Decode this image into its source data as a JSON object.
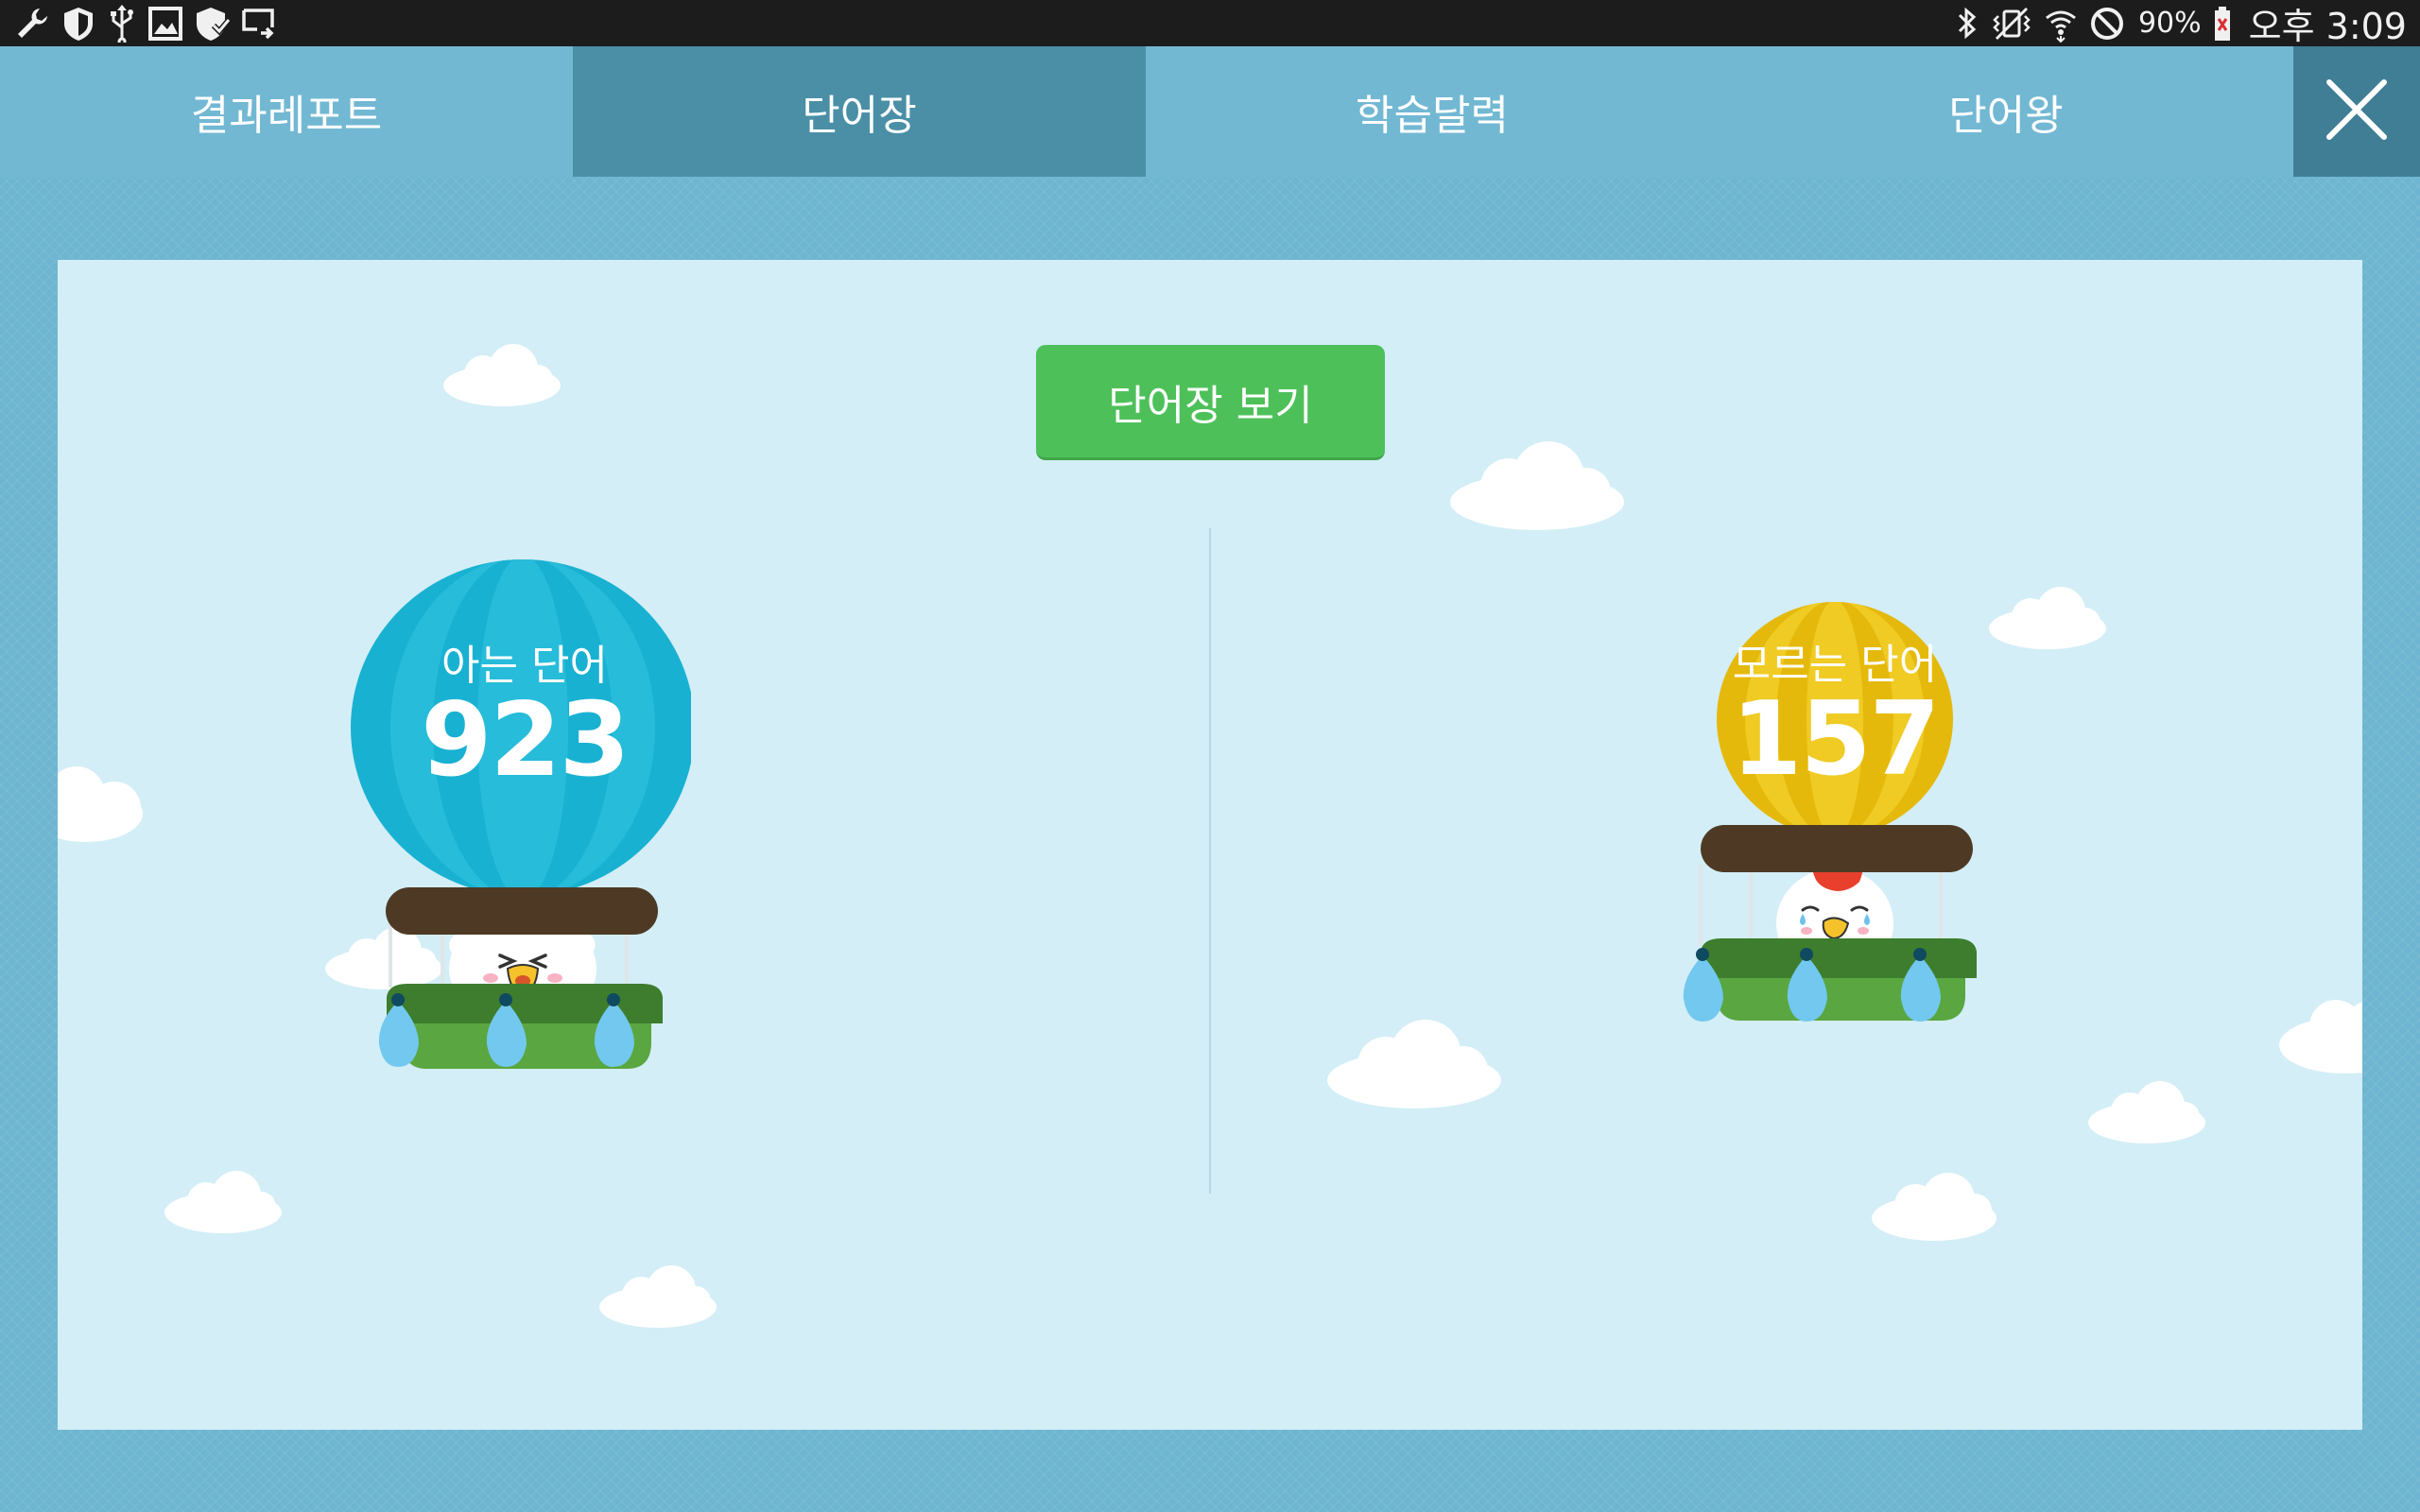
{
  "status_bar": {
    "left_icons": [
      "wrench-icon",
      "shield-icon",
      "usb-icon",
      "image-icon",
      "shield-check-icon",
      "screen-mirror-icon"
    ],
    "right_icons": [
      "bluetooth-icon",
      "vibrate-icon",
      "wifi-icon",
      "block-icon",
      "battery-icon"
    ],
    "battery": "90%",
    "time": "오후 3:09"
  },
  "tabs": [
    {
      "label": "결과레포트",
      "active": false
    },
    {
      "label": "단어장",
      "active": true
    },
    {
      "label": "학습달력",
      "active": false
    },
    {
      "label": "단어왕",
      "active": false
    }
  ],
  "close_icon": "close-icon",
  "main": {
    "view_wordbook_label": "단어장 보기",
    "known": {
      "label": "아는 단어",
      "count": "923",
      "balloon_color": "#1fb3d3"
    },
    "unknown": {
      "label": "모르는 단어",
      "count": "157",
      "balloon_color": "#e9c10d"
    }
  },
  "colors": {
    "tab_active": "#4a8fa6",
    "tab_bar": "#72b8d3",
    "panel": "#d3eef7",
    "button_green": "#4ec05a",
    "close_bg": "#3f7e94"
  }
}
